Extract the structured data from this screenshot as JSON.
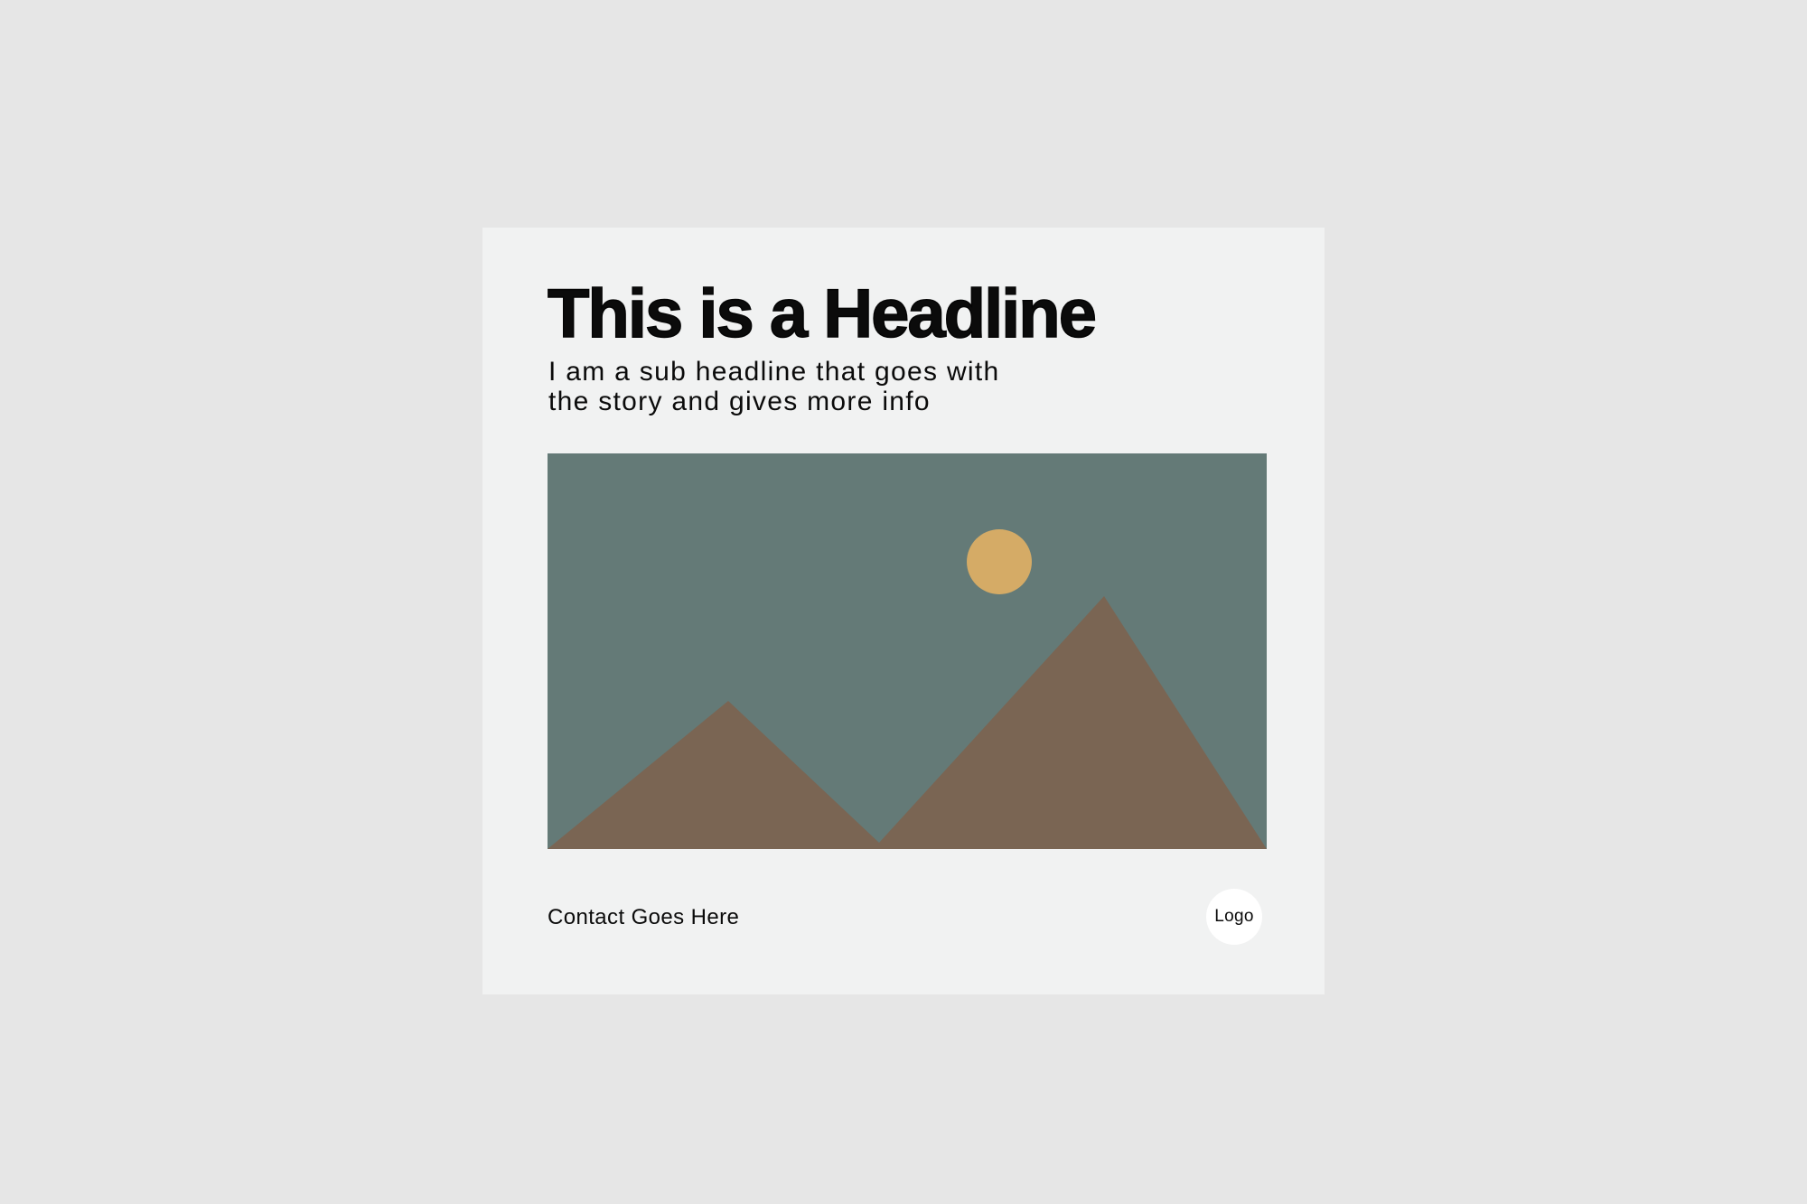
{
  "colors": {
    "page_background": "#e6e6e6",
    "card_background": "#f1f2f2",
    "text": "#0b0b0b",
    "sky": "#647a77",
    "mountains": "#7a6553",
    "sun": "#d5ab66",
    "logo_background": "#ffffff"
  },
  "card": {
    "headline": "This is a Headline",
    "subheadline_lines": [
      "I am a sub headline that goes with",
      "the story and gives more info"
    ],
    "image": {
      "icon": "landscape-illustration",
      "elements": [
        "sky",
        "sun",
        "mountains"
      ]
    },
    "contact": "Contact Goes Here",
    "logo_label": "Logo"
  }
}
